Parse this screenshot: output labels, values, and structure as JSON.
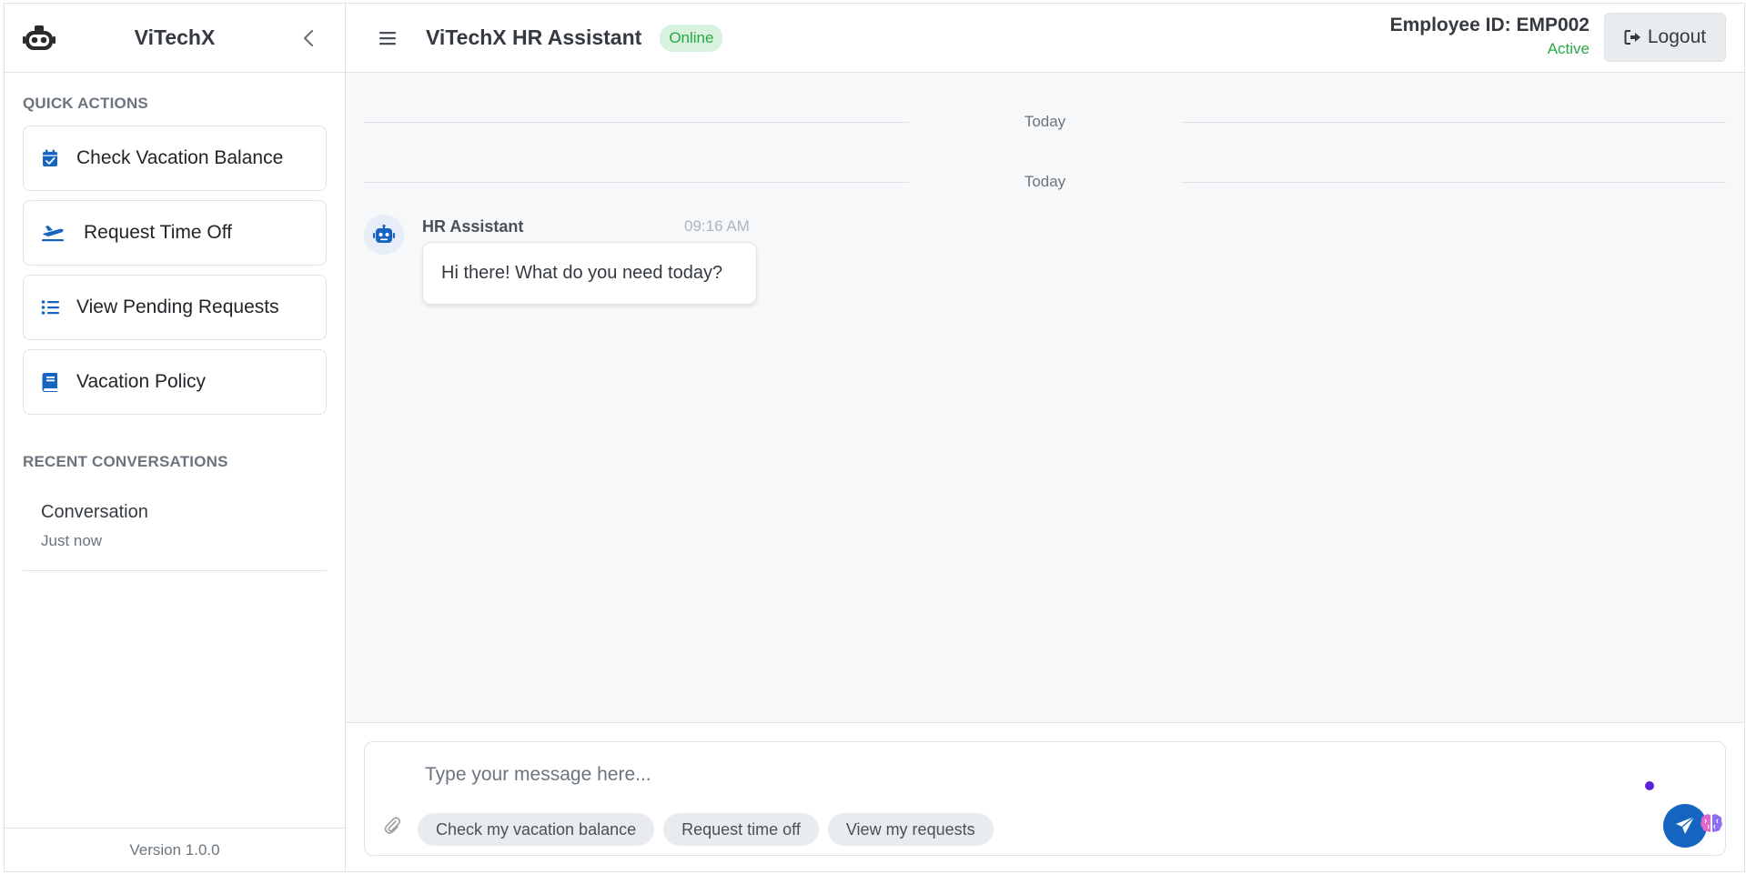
{
  "sidebar": {
    "brand": "ViTechX",
    "quick_actions_title": "QUICK ACTIONS",
    "quick_actions": [
      {
        "label": "Check Vacation Balance",
        "icon": "calendar-check-icon"
      },
      {
        "label": "Request Time Off",
        "icon": "plane-icon"
      },
      {
        "label": "View Pending Requests",
        "icon": "list-icon"
      },
      {
        "label": "Vacation Policy",
        "icon": "book-icon"
      }
    ],
    "recent_title": "RECENT CONVERSATIONS",
    "conversations": [
      {
        "title": "Conversation",
        "time": "Just now"
      }
    ],
    "version": "Version 1.0.0"
  },
  "header": {
    "title": "ViTechX HR Assistant",
    "status": "Online",
    "employee_id": "Employee ID: EMP002",
    "employee_status": "Active",
    "logout_label": "Logout"
  },
  "chat": {
    "dividers": [
      "Today",
      "Today"
    ],
    "messages": [
      {
        "sender": "HR Assistant",
        "time": "09:16 AM",
        "text": "Hi there! What do you need today?"
      }
    ]
  },
  "composer": {
    "placeholder": "Type your message here...",
    "suggestions": [
      "Check my vacation balance",
      "Request time off",
      "View my requests"
    ]
  },
  "colors": {
    "accent": "#1565c0",
    "online": "#28a745",
    "online_bg": "#d9f2df"
  }
}
